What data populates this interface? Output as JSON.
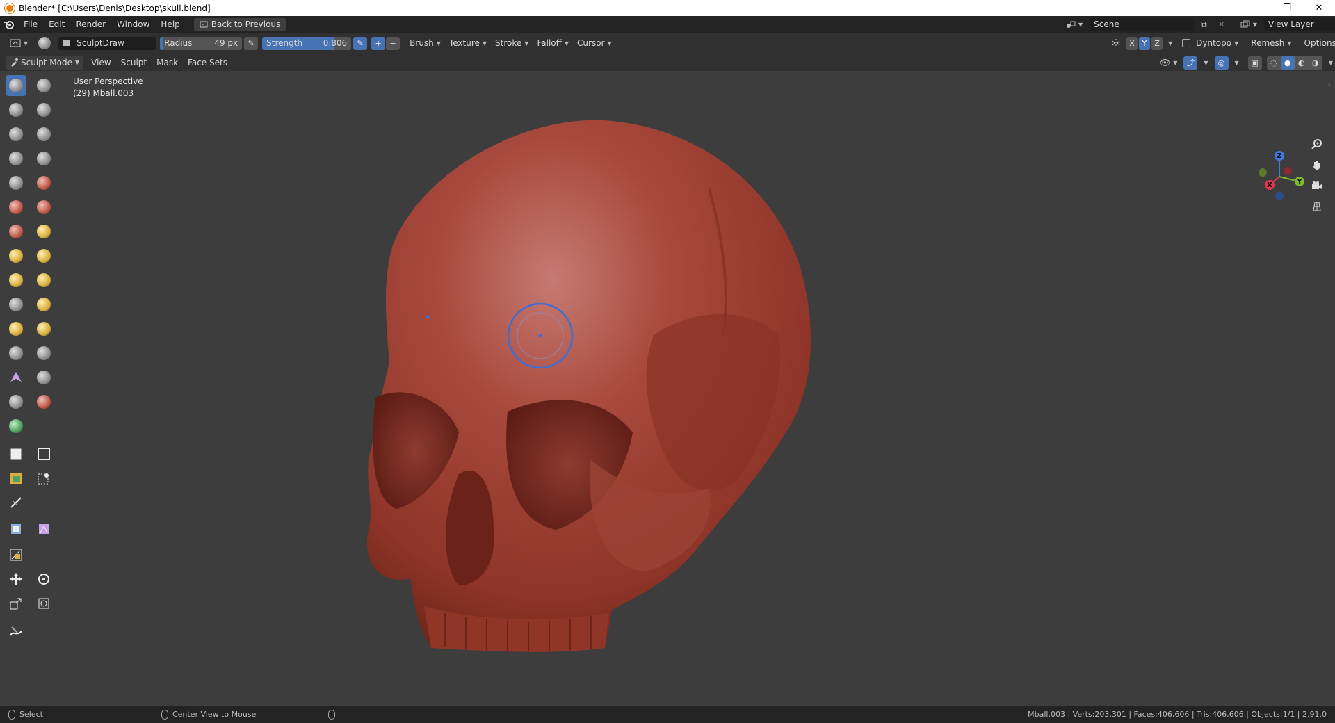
{
  "titlebar": {
    "title": "Blender* [C:\\Users\\Denis\\Desktop\\skull.blend]",
    "minimize": "—",
    "restore": "❐",
    "close": "✕"
  },
  "topbar": {
    "menus": [
      "File",
      "Edit",
      "Render",
      "Window",
      "Help"
    ],
    "back_button": "Back to Previous",
    "scene_label": "Scene",
    "view_layer_label": "View Layer"
  },
  "toolheader": {
    "brush_name": "SculptDraw",
    "radius_label": "Radius",
    "radius_value": "49 px",
    "strength_label": "Strength",
    "strength_value": "0.806",
    "strength_fraction": 0.806,
    "menus": [
      "Brush",
      "Texture",
      "Stroke",
      "Falloff",
      "Cursor"
    ],
    "axis": [
      "X",
      "Y",
      "Z"
    ],
    "dyntopo_label": "Dyntopo",
    "remesh_label": "Remesh",
    "options_label": "Options"
  },
  "vpheader": {
    "mode_label": "Sculpt Mode",
    "menus": [
      "View",
      "Sculpt",
      "Mask",
      "Face Sets"
    ]
  },
  "viewport": {
    "view_name": "User Perspective",
    "object_info": "(29) Mball.003"
  },
  "gizmo": {
    "z": "Z",
    "y": "Y",
    "x": "X"
  },
  "statusbar": {
    "select": "Select",
    "center_view": "Center View to Mouse",
    "stats": "Mball.003 | Verts:203,301 | Faces:406,606 | Tris:406,606 | Objects:1/1 | 2.91.0"
  },
  "colors": {
    "accent": "#4772b3",
    "skull": "#a3453a",
    "viewport_bg": "#3d3d3d"
  }
}
